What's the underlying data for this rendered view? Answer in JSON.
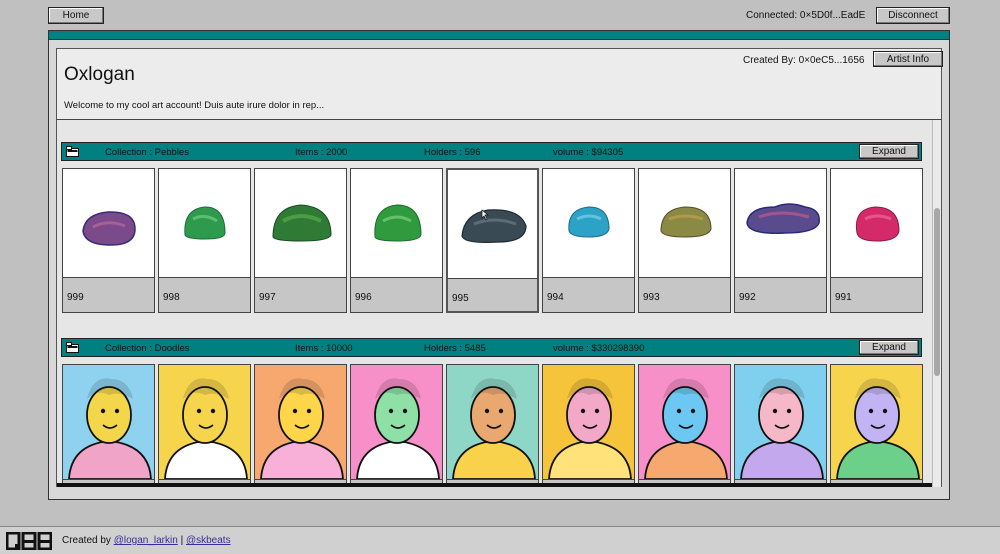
{
  "nav": {
    "home_label": "Home",
    "connected_text": "Connected: 0×5D0f...EadE",
    "disconnect_label": "Disconnect"
  },
  "artist": {
    "name": "Oxlogan",
    "welcome": "Welcome to my cool art account! Duis aute irure dolor in rep...",
    "created_by": "Created By: 0×0eC5...1656",
    "info_label": "Artist Info"
  },
  "collections": [
    {
      "collection": "Collection : Pebbles",
      "items": "Items : 2000",
      "holders": "Holders : 596",
      "volume": "volume : $94305",
      "expand_label": "Expand",
      "cards": [
        {
          "id": "999",
          "color": "#7a4a8a"
        },
        {
          "id": "998",
          "color": "#2e9a4e"
        },
        {
          "id": "997",
          "color": "#2f7a35"
        },
        {
          "id": "996",
          "color": "#2f9a3e"
        },
        {
          "id": "995",
          "color": "#3a4a55"
        },
        {
          "id": "994",
          "color": "#2ca3c6"
        },
        {
          "id": "993",
          "color": "#8a8a45"
        },
        {
          "id": "992",
          "color": "#5a4a8e"
        },
        {
          "id": "991",
          "color": "#d42a6a"
        }
      ]
    },
    {
      "collection": "Collection : Doodles",
      "items": "Items : 10000",
      "holders": "Holders : 5485",
      "volume": "volume : $330298390",
      "expand_label": "Expand",
      "cards": [
        {
          "bg": "#8fd2ef",
          "face": "#f4d64a",
          "body": "#f0a4c8"
        },
        {
          "bg": "#f6d44c",
          "face": "#f6d44c",
          "body": "#ffffff"
        },
        {
          "bg": "#f7a86e",
          "face": "#ffd54a",
          "body": "#f8b0d8"
        },
        {
          "bg": "#f78fc8",
          "face": "#8ee0a6",
          "body": "#ffffff"
        },
        {
          "bg": "#8ed6c6",
          "face": "#e8a870",
          "body": "#f8d24a"
        },
        {
          "bg": "#f6c43a",
          "face": "#f4a8c8",
          "body": "#ffe27a"
        },
        {
          "bg": "#f78fc8",
          "face": "#6cc8f2",
          "body": "#f7a86e"
        },
        {
          "bg": "#7fd0ee",
          "face": "#f6b8c8",
          "body": "#c4a8ee"
        },
        {
          "bg": "#f6d44c",
          "face": "#c2b4f4",
          "body": "#6cd08a"
        }
      ]
    }
  ],
  "footer": {
    "created_by": "Created by",
    "handle1": "@logan_larkin",
    "separator": "|",
    "handle2": "@skbeats"
  },
  "colors": {
    "teal": "#008080",
    "background": "#c0c0c0",
    "link": "#3a2c9a"
  }
}
